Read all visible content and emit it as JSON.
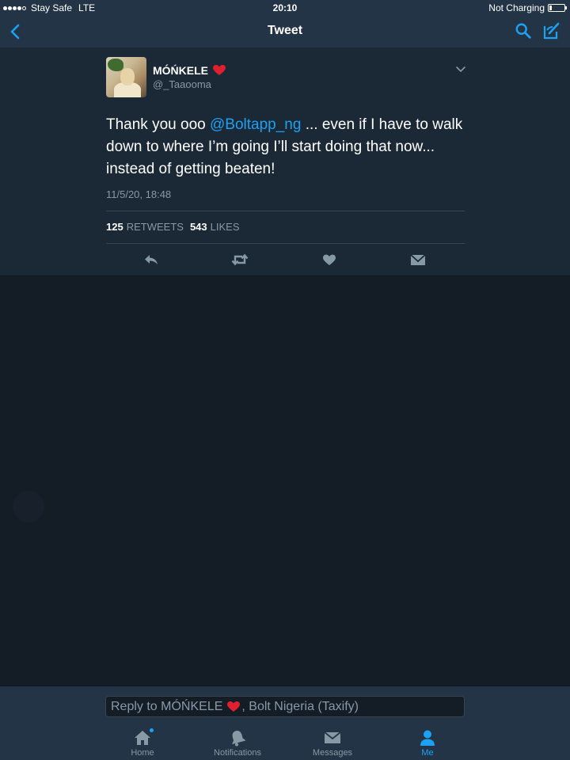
{
  "status_bar": {
    "carrier": "Stay Safe",
    "network": "LTE",
    "time": "20:10",
    "battery_status": "Not Charging",
    "battery_level": 0.15
  },
  "nav": {
    "title": "Tweet",
    "back_icon": "chevron-left-icon",
    "search_icon": "search-icon",
    "compose_icon": "compose-icon"
  },
  "tweet": {
    "display_name": "MÓŃKELE",
    "handle": "@_Taaooma",
    "text_before": "Thank you ooo ",
    "mention": "@Boltapp_ng",
    "text_after": " ... even if I have to walk down to where I’m going I’ll start doing that now... instead of getting beaten!",
    "timestamp": "11/5/20, 18:48",
    "retweets_count": "125",
    "retweets_label": "RETWEETS",
    "likes_count": "543",
    "likes_label": "LIKES",
    "actions": [
      "reply-icon",
      "retweet-icon",
      "like-icon",
      "direct-message-icon"
    ]
  },
  "reply": {
    "prefix": "Reply to MÓŃKELE",
    "suffix": ", Bolt Nigeria (Taxify)"
  },
  "tab_bar": {
    "tabs": [
      {
        "label": "Home",
        "icon": "home-icon"
      },
      {
        "label": "Notifications",
        "icon": "bell-icon"
      },
      {
        "label": "Messages",
        "icon": "envelope-icon"
      },
      {
        "label": "Me",
        "icon": "person-icon"
      }
    ],
    "active_tab": "Me"
  },
  "colors": {
    "accent": "#1da1f2",
    "background": "#141d26",
    "card": "#1b2836",
    "bar": "#243447",
    "muted_text": "#8899a6"
  }
}
